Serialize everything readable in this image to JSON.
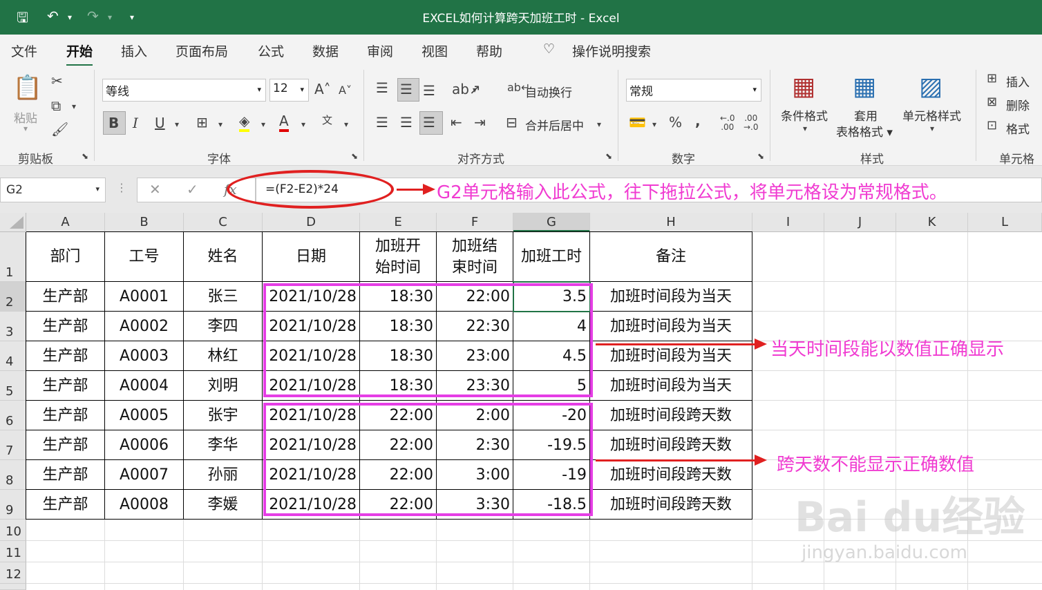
{
  "window": {
    "title": "EXCEL如何计算跨天加班工时  -  Excel"
  },
  "tabs": [
    "文件",
    "开始",
    "插入",
    "页面布局",
    "公式",
    "数据",
    "审阅",
    "视图",
    "帮助"
  ],
  "tell_me": "操作说明搜索",
  "ribbon": {
    "clipboard": {
      "paste": "粘贴",
      "label": "剪贴板"
    },
    "font": {
      "name": "等线",
      "size": "12",
      "bold": "B",
      "italic": "I",
      "underline": "U",
      "label": "字体"
    },
    "alignment": {
      "wrap": "自动换行",
      "merge": "合并后居中",
      "label": "对齐方式"
    },
    "number": {
      "format": "常规",
      "percent": "%",
      "comma": ",",
      "label": "数字"
    },
    "styles": {
      "conditional": "条件格式",
      "table": "套用\n表格格式",
      "cell_styles": "单元格样式",
      "label": "样式"
    },
    "cells": {
      "insert": "插入",
      "delete": "删除",
      "format": "格式",
      "label": "单元格"
    }
  },
  "formula_bar": {
    "name_box": "G2",
    "formula": "=(F2-E2)*24"
  },
  "columns": [
    "A",
    "B",
    "C",
    "D",
    "E",
    "F",
    "G",
    "H",
    "I",
    "J",
    "K",
    "L"
  ],
  "rows": [
    "1",
    "2",
    "3",
    "4",
    "5",
    "6",
    "7",
    "8",
    "9",
    "10",
    "11",
    "12"
  ],
  "table": {
    "headers": [
      "部门",
      "工号",
      "姓名",
      "日期",
      "加班开\n始时间",
      "加班结\n束时间",
      "加班工时",
      "备注"
    ],
    "data": [
      [
        "生产部",
        "A0001",
        "张三",
        "2021/10/28",
        "18:30",
        "22:00",
        "3.5",
        "加班时间段为当天"
      ],
      [
        "生产部",
        "A0002",
        "李四",
        "2021/10/28",
        "18:30",
        "22:30",
        "4",
        "加班时间段为当天"
      ],
      [
        "生产部",
        "A0003",
        "林红",
        "2021/10/28",
        "18:30",
        "23:00",
        "4.5",
        "加班时间段为当天"
      ],
      [
        "生产部",
        "A0004",
        "刘明",
        "2021/10/28",
        "18:30",
        "23:30",
        "5",
        "加班时间段为当天"
      ],
      [
        "生产部",
        "A0005",
        "张宇",
        "2021/10/28",
        "22:00",
        "2:00",
        "-20",
        "加班时间段跨天数"
      ],
      [
        "生产部",
        "A0006",
        "李华",
        "2021/10/28",
        "22:00",
        "2:30",
        "-19.5",
        "加班时间段跨天数"
      ],
      [
        "生产部",
        "A0007",
        "孙丽",
        "2021/10/28",
        "22:00",
        "3:00",
        "-19",
        "加班时间段跨天数"
      ],
      [
        "生产部",
        "A0008",
        "李媛",
        "2021/10/28",
        "22:00",
        "3:30",
        "-18.5",
        "加班时间段跨天数"
      ]
    ]
  },
  "annotations": {
    "formula_note": "G2单元格输入此公式，往下拖拉公式，将单元格设为常规格式。",
    "same_day_note": "当天时间段能以数值正确显示",
    "cross_day_note": "跨天数不能显示正确数值"
  },
  "watermark": {
    "main": "Bai du经验",
    "sub": "jingyan.baidu.com"
  },
  "colors": {
    "excel_green": "#217346",
    "highlight_pink": "#e53ee5",
    "arrow_red": "#e02020",
    "annotation_pink": "#f03bd1"
  }
}
